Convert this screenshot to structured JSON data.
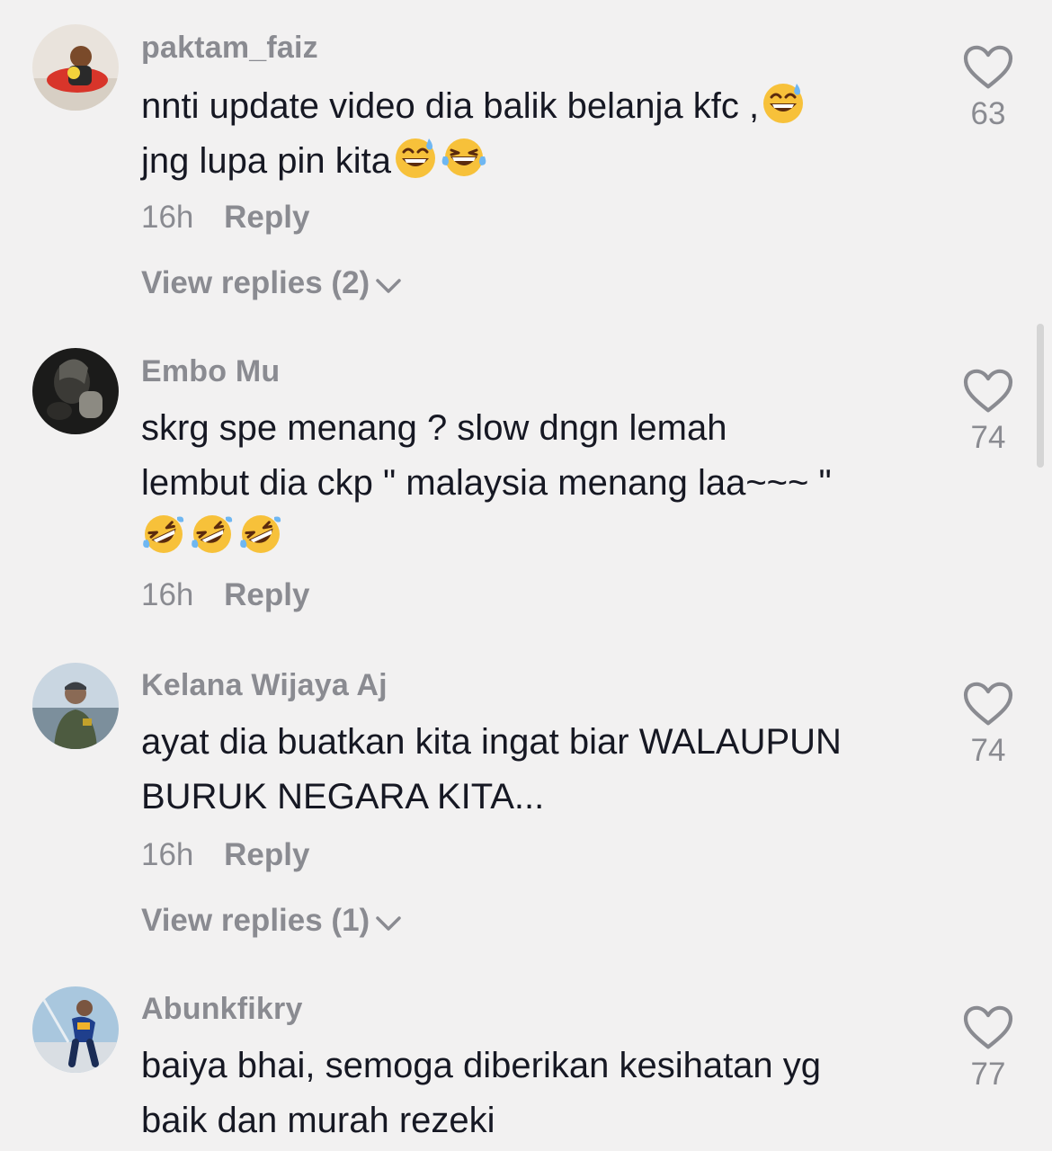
{
  "comments": [
    {
      "username": "paktam_faiz",
      "line1": "nnti update video dia balik belanja kfc ,",
      "line2": "jng lupa pin kita",
      "time": "16h",
      "reply": "Reply",
      "view_replies": "View replies (2)",
      "likes": "63",
      "emojis": [
        "grinning-sweat-emoji",
        "grinning-sweat-emoji",
        "tears-of-joy-emoji"
      ]
    },
    {
      "username": "Embo Mu",
      "line1": "skrg spe menang ? slow dngn lemah",
      "line2": "lembut dia ckp \" malaysia menang laa~~~ \"",
      "time": "16h",
      "reply": "Reply",
      "likes": "74",
      "emojis": [
        "rolling-laughing-emoji",
        "rolling-laughing-emoji",
        "rolling-laughing-emoji"
      ]
    },
    {
      "username": "Kelana Wijaya Aj",
      "line1": "ayat dia buatkan kita ingat biar WALAUPUN",
      "line2": "BURUK NEGARA KITA...",
      "time": "16h",
      "reply": "Reply",
      "view_replies": "View replies (1)",
      "likes": "74"
    },
    {
      "username": "Abunkfikry",
      "line1": "baiya bhai, semoga diberikan kesihatan yg",
      "line2": "baik dan murah rezeki",
      "likes": "77"
    }
  ],
  "icons": {
    "like": "heart-outline-icon",
    "expand": "chevron-down-icon"
  },
  "colors": {
    "background": "#f2f1f1",
    "text": "#161823",
    "muted": "#8a8b91"
  }
}
